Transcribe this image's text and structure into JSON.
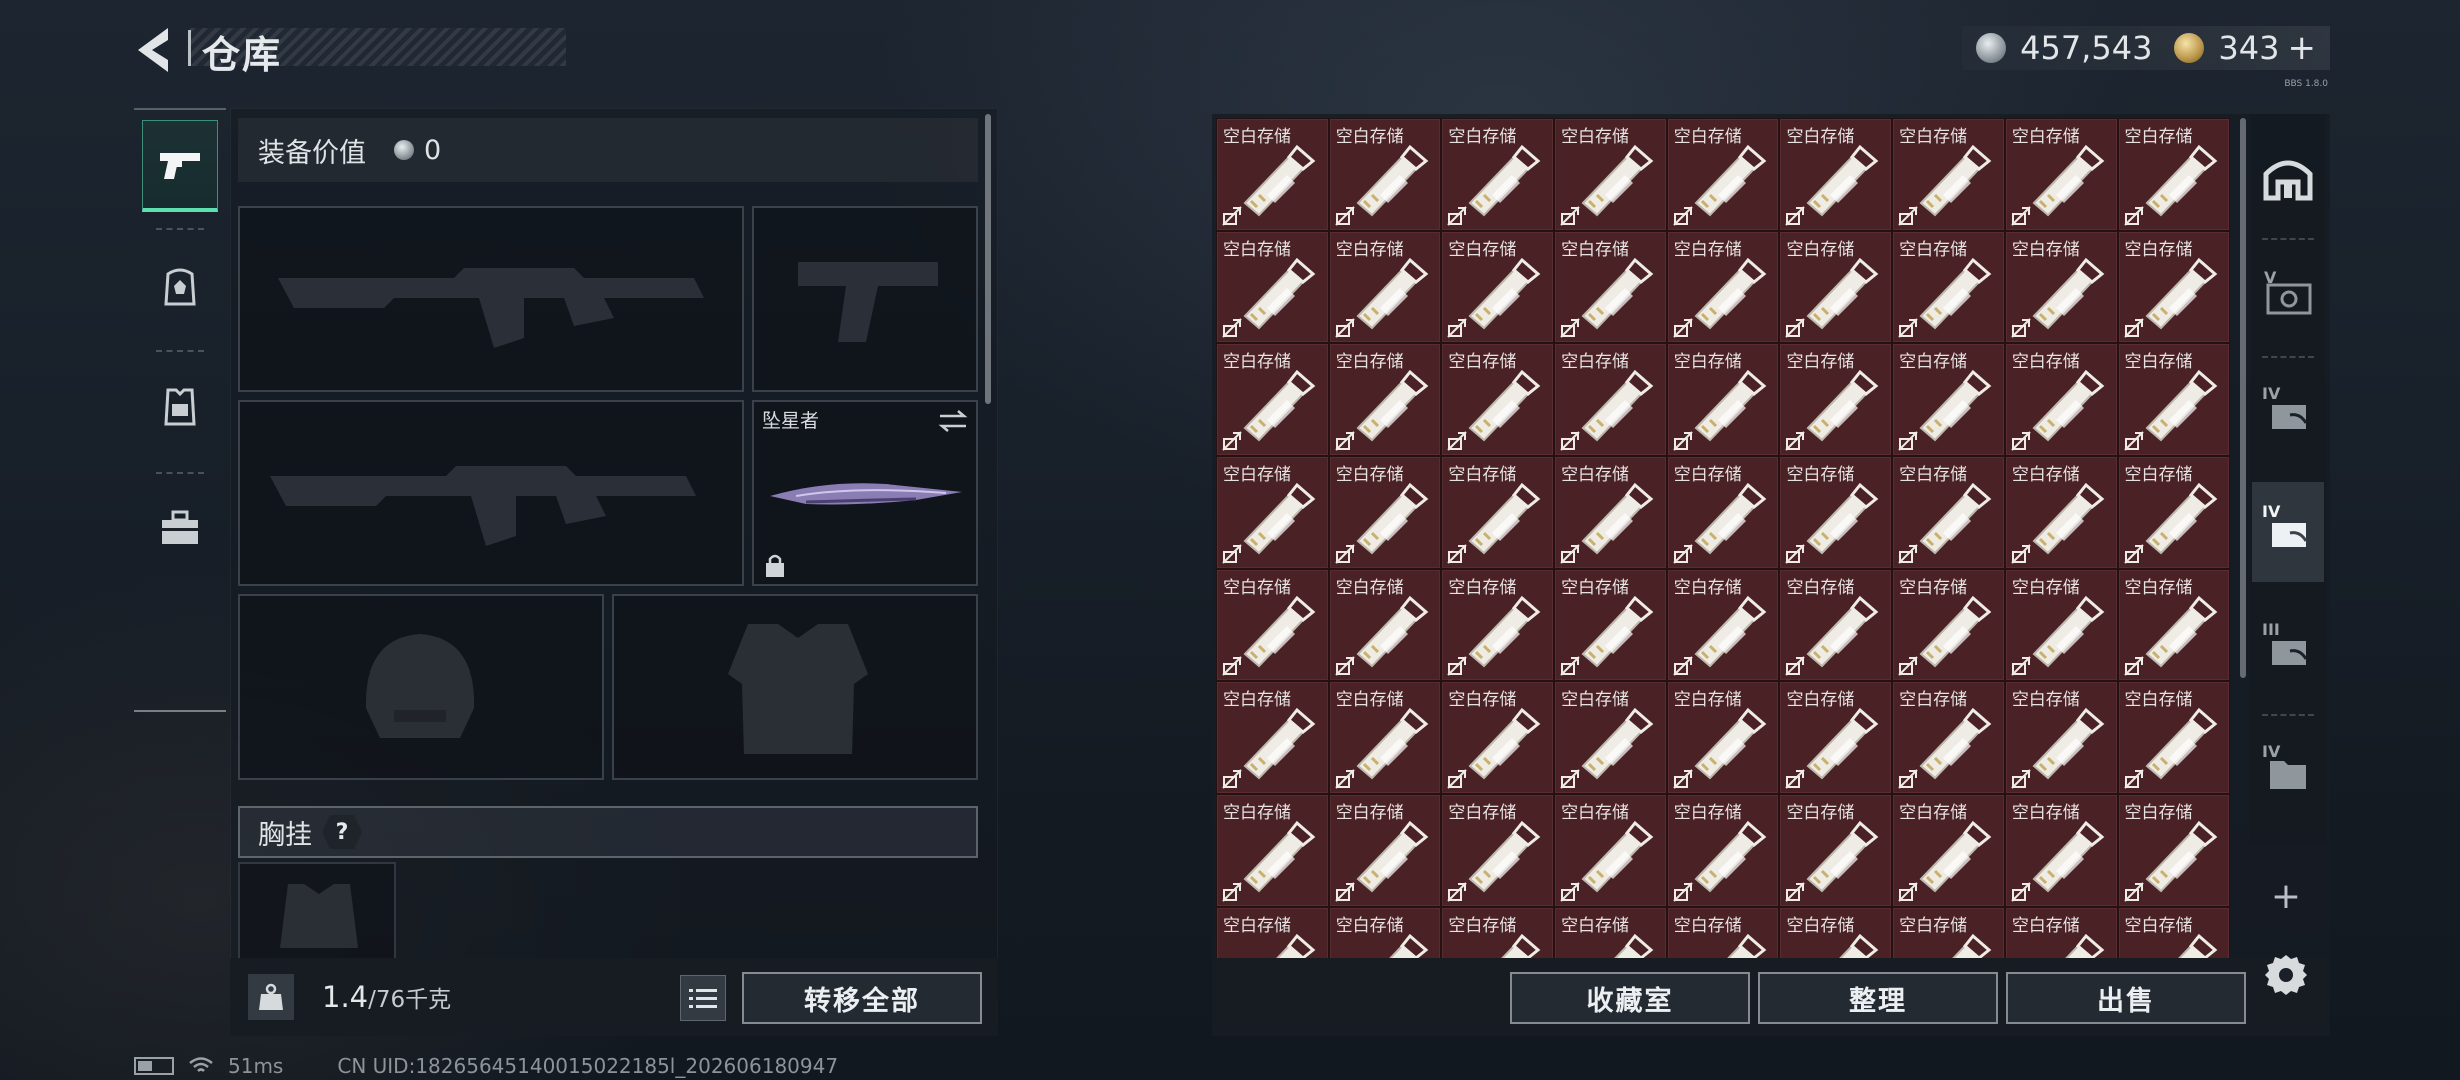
{
  "header": {
    "title": "仓库",
    "currency_silver": "457,543",
    "currency_gold": "343",
    "plus_label": "+",
    "tiny_tag": "BBS 1.8.0"
  },
  "equipment": {
    "value_label": "装备价值",
    "value": "0",
    "melee_name": "坠星者",
    "chest_label": "胸挂",
    "chest_help": "?",
    "weight_current": "1.4",
    "weight_max": "/76千克",
    "transfer_all": "转移全部"
  },
  "storage": {
    "cell_label": "空白存储",
    "cell_count": 72,
    "buttons": {
      "collection": "收藏室",
      "organize": "整理",
      "sell": "出售"
    }
  },
  "right_nav": {
    "add_label": "+",
    "labels": [
      "V",
      "IV",
      "IV",
      "III",
      "IV"
    ]
  },
  "status": {
    "ping": "51ms",
    "uid": "CN UID:18265645140015022185l_202606180947"
  },
  "colors": {
    "accent": "#5fe0b0",
    "cell_bg": "#4a2226",
    "panel": "#161c23"
  },
  "icons": [
    "back-arrow-icon",
    "silver-coin-icon",
    "gold-coin-icon",
    "pistol-icon",
    "backpack-icon",
    "vest-icon",
    "toolbox-icon",
    "swap-icon",
    "lock-icon",
    "weight-icon",
    "list-icon",
    "vault-icon",
    "gear-icon"
  ]
}
